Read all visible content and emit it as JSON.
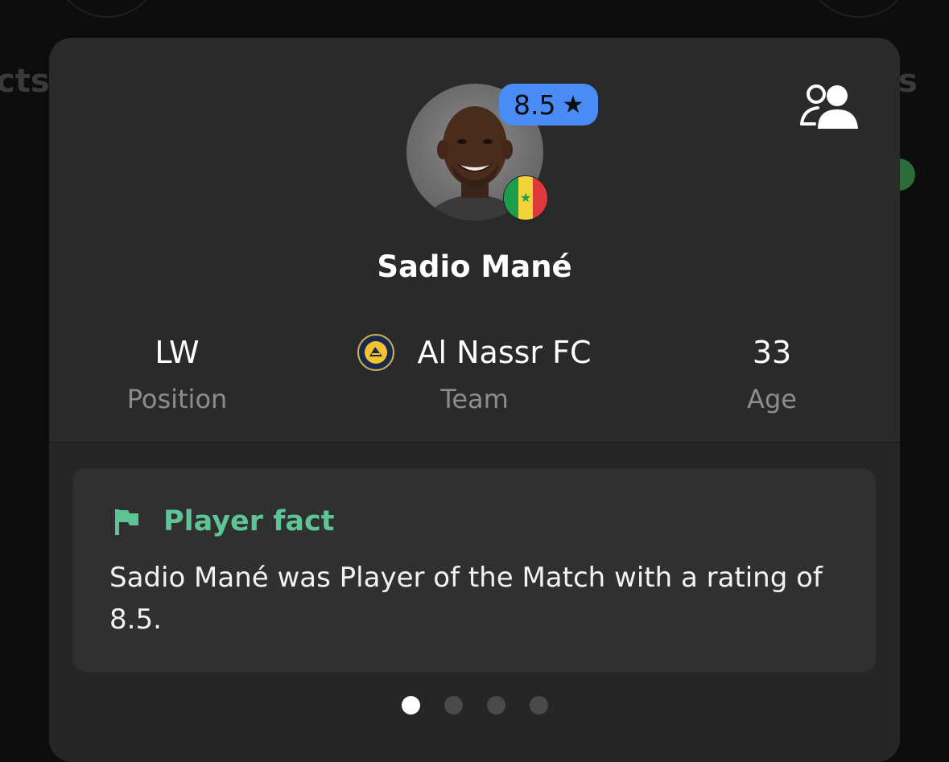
{
  "background": {
    "left_partial": "cts",
    "right_partial": "s"
  },
  "player": {
    "name": "Sadio Mané",
    "rating": "8.5",
    "rating_icon": "star-icon",
    "nationality_flag": "senegal-flag-icon"
  },
  "stats": [
    {
      "value": "LW",
      "label": "Position"
    },
    {
      "value": "Al Nassr FC",
      "label": "Team"
    },
    {
      "value": "33",
      "label": "Age"
    }
  ],
  "fact": {
    "title": "Player fact",
    "text": "Sadio Mané was Player of the Match with a rating of 8.5."
  },
  "pagination": {
    "total": 4,
    "active": 1
  },
  "colors": {
    "rating_badge": "#4a8cf5",
    "fact_title": "#5fc495",
    "card": "#2a2a2a"
  }
}
